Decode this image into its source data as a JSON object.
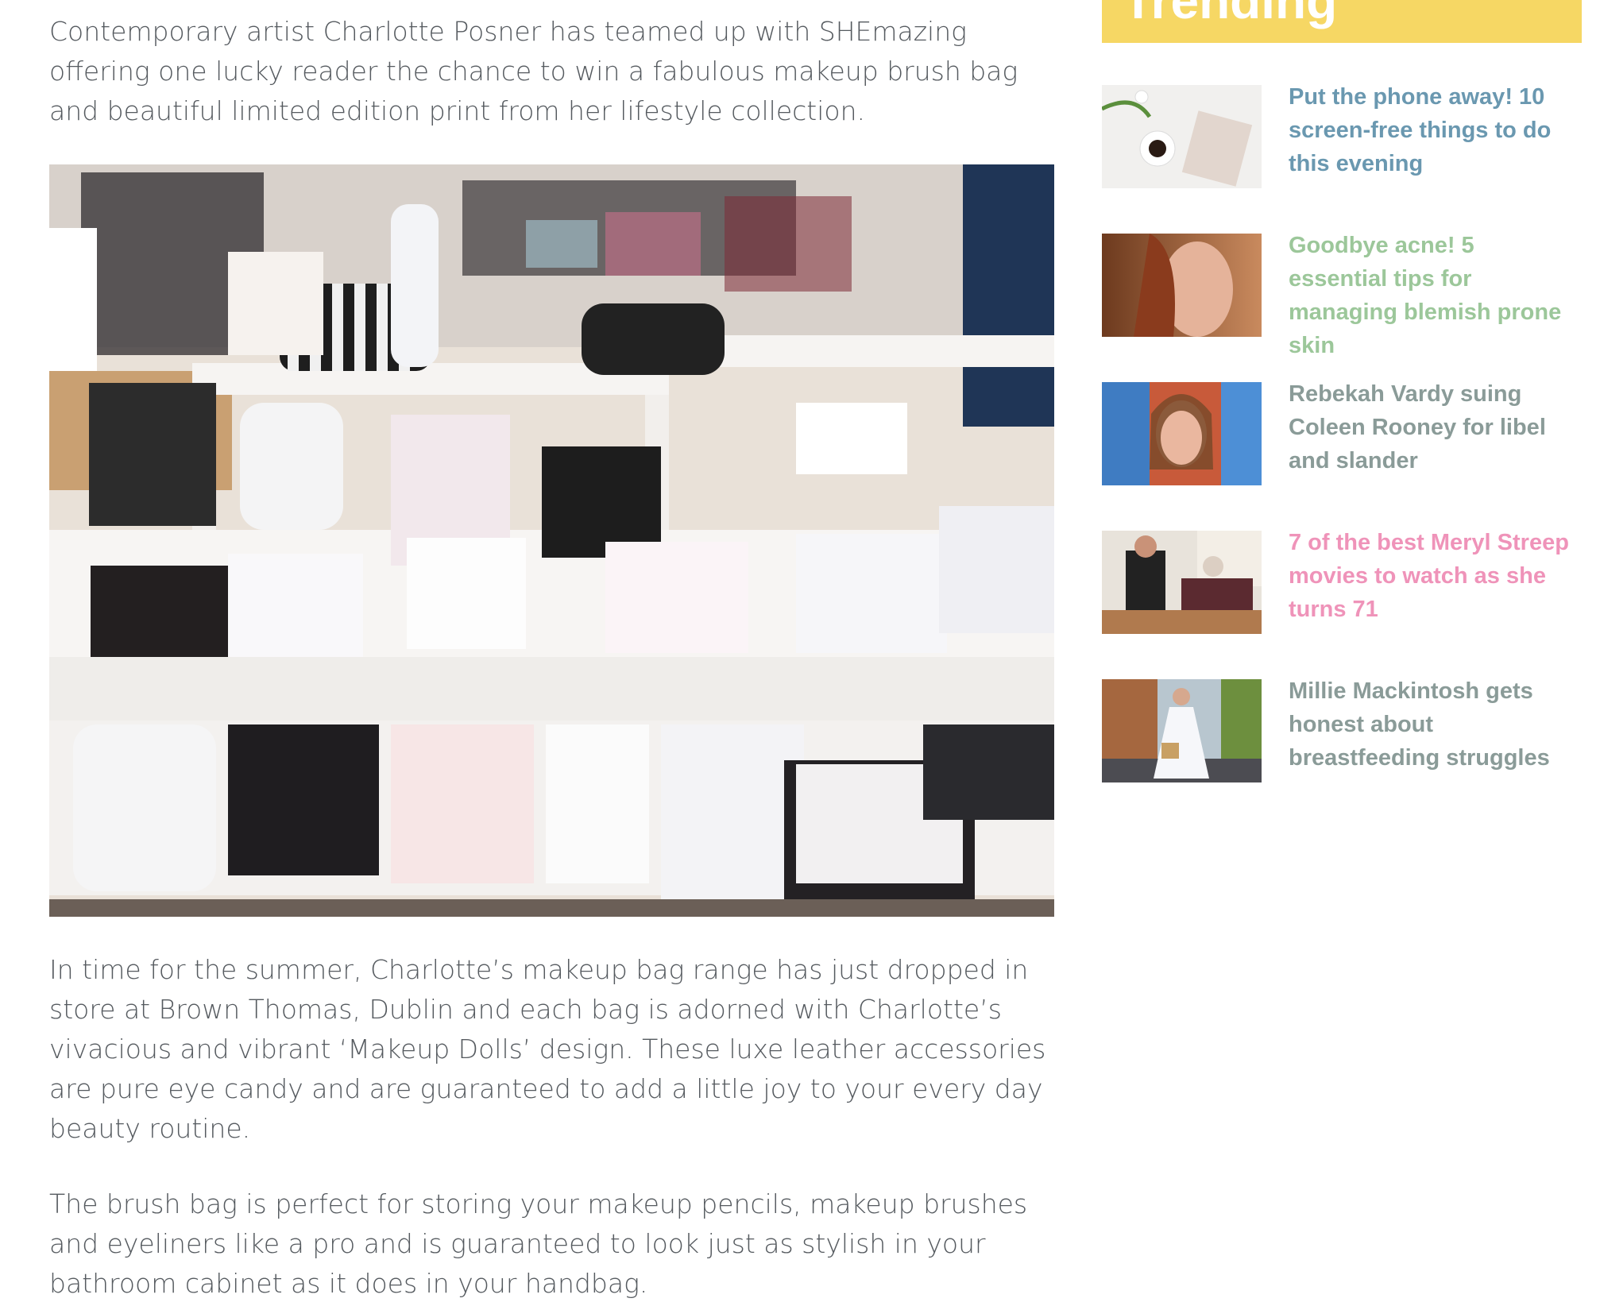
{
  "article": {
    "paragraphs": [
      "Contemporary artist Charlotte Posner has teamed up with SHEmazing offering one lucky reader the chance to win a fabulous makeup brush bag and beautiful limited edition print from her lifestyle collection.",
      "In time for the summer, Charlotte’s makeup bag range has just dropped in store at Brown Thomas, Dublin and each bag is adorned with Charlotte’s vivacious and vibrant ‘Makeup Dolls’ design. These luxe leather accessories are pure eye candy and are guaranteed to add a little joy to your every day beauty routine.",
      "The brush bag is perfect for storing your makeup pencils, makeup brushes and eyeliners like a pro and is guaranteed to look just as stylish in your bathroom cabinet as it does in your handbag."
    ]
  },
  "sidebar": {
    "header": "Trending",
    "header_color": "#f6d764",
    "items": [
      {
        "title": "Put the phone away! 10 screen-free things to do this evening",
        "color": "#6a98b0"
      },
      {
        "title": "Goodbye acne! 5 essential tips for managing blemish prone skin",
        "color": "#9cc79a"
      },
      {
        "title": "Rebekah Vardy suing Coleen Rooney for libel and slander",
        "color": "#8a9b98"
      },
      {
        "title": "7 of the best Meryl Streep movies to watch as she turns 71",
        "color": "#ef93b9"
      },
      {
        "title": "Millie Mackintosh gets honest about breastfeeding struggles",
        "color": "#8a9b98"
      }
    ]
  }
}
